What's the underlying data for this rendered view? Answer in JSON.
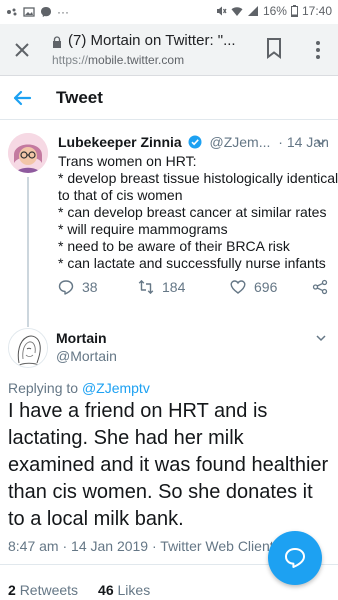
{
  "status_bar": {
    "battery": "16%",
    "time": "17:40"
  },
  "browser": {
    "tab_title": "(7) Mortain on Twitter: \"...",
    "url_scheme": "https://",
    "url_host": "mobile.twitter.com"
  },
  "header": {
    "title": "Tweet"
  },
  "parent_tweet": {
    "author_name": "Lubekeeper Zinnia",
    "author_handle": "@ZJem...",
    "date": "· 14 Jan",
    "lines": [
      "Trans women on HRT:",
      "* develop breast tissue histologically identical",
      "to that of cis women",
      "* can develop breast cancer at similar rates",
      "* will require mammograms",
      "* need to be aware of their BRCA risk",
      "* can lactate and successfully nurse infants"
    ],
    "replies": "38",
    "retweets": "184",
    "likes": "696"
  },
  "main_tweet": {
    "author_name": "Mortain",
    "author_handle": "@Mortain",
    "replying_label": "Replying to ",
    "replying_handle": "@ZJemptv",
    "lines": [
      "I have a friend on HRT and is",
      "lactating. She had her milk",
      "examined and it was found healthier",
      "than cis women. So she donates it",
      "to a local milk bank."
    ],
    "meta": "8:47 am · 14 Jan 2019 · Twitter Web Client",
    "retweet_count": "2",
    "retweet_label": "Retweets",
    "like_count": "46",
    "like_label": "Likes"
  },
  "colors": {
    "accent": "#1da1f2",
    "secondary_text": "#657786",
    "primary_text": "#14171a"
  }
}
